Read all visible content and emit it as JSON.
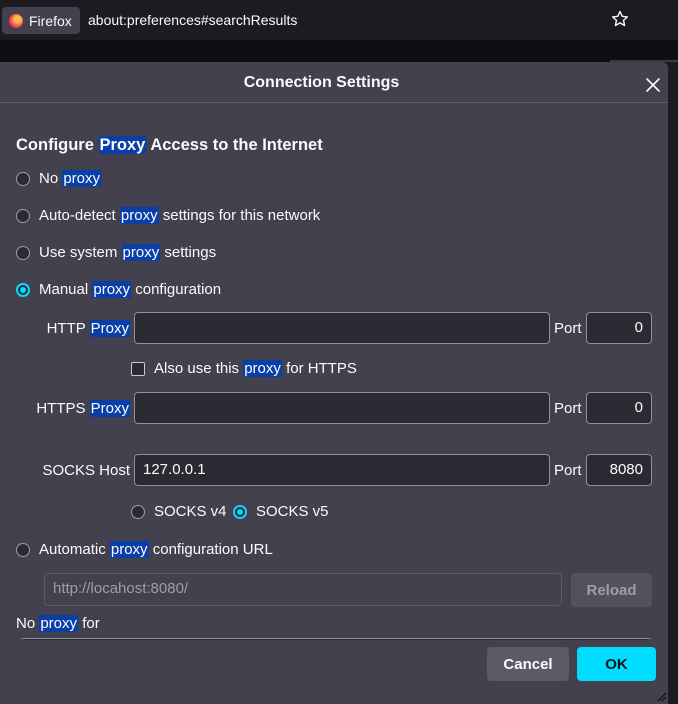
{
  "browser": {
    "app_name": "Firefox",
    "url": "about:preferences#searchResults"
  },
  "dialog": {
    "title": "Connection Settings",
    "section": {
      "before": "Configure ",
      "highlight": "Proxy",
      "after": " Access to the Internet"
    },
    "options": {
      "no_proxy": {
        "before": "No ",
        "highlight": "proxy",
        "after": ""
      },
      "auto_detect": {
        "before": "Auto-detect ",
        "highlight": "proxy",
        "after": " settings for this network"
      },
      "system": {
        "before": "Use system ",
        "highlight": "proxy",
        "after": " settings"
      },
      "manual": {
        "before": "Manual ",
        "highlight": "proxy",
        "after": " configuration",
        "selected": true
      },
      "auto_url": {
        "before": "Automatic ",
        "highlight": "proxy",
        "after": " configuration URL"
      }
    },
    "http": {
      "label_before": "HTTP ",
      "label_highlight": "Proxy",
      "value": "",
      "port_label": "Port",
      "port": "0"
    },
    "https_checkbox": {
      "before": "Also use this ",
      "highlight": "proxy",
      "after": " for HTTPS",
      "checked": false
    },
    "https": {
      "label_before": "HTTPS ",
      "label_highlight": "Proxy",
      "value": "",
      "port_label": "Port",
      "port": "0"
    },
    "socks": {
      "label": "SOCKS Host",
      "value": "127.0.0.1",
      "port_label": "Port",
      "port": "8080",
      "v4": "SOCKS v4",
      "v5": "SOCKS v5",
      "selected": "v5"
    },
    "pac_url": {
      "placeholder": "http://locahost:8080/",
      "reload": "Reload"
    },
    "no_proxy_for": {
      "before": "No ",
      "highlight": "proxy",
      "after": " for"
    },
    "buttons": {
      "cancel": "Cancel",
      "ok": "OK"
    }
  },
  "colors": {
    "accent": "#00ddff",
    "highlight": "#0b3fa8",
    "dialog_bg": "#42414d"
  }
}
